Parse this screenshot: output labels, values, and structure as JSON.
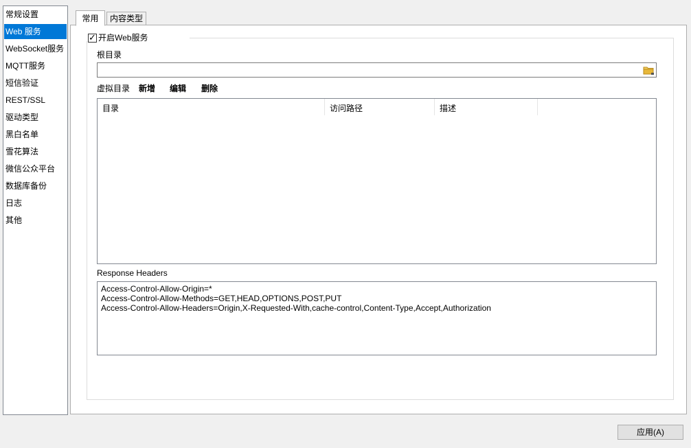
{
  "sidebar": {
    "items": [
      {
        "label": "常规设置"
      },
      {
        "label": "Web 服务"
      },
      {
        "label": "WebSocket服务"
      },
      {
        "label": "MQTT服务"
      },
      {
        "label": "短信验证"
      },
      {
        "label": "REST/SSL"
      },
      {
        "label": "驱动类型"
      },
      {
        "label": "黑白名单"
      },
      {
        "label": "雪花算法"
      },
      {
        "label": "微信公众平台"
      },
      {
        "label": "数据库备份"
      },
      {
        "label": "日志"
      },
      {
        "label": "其他"
      }
    ],
    "selected": "Web 服务"
  },
  "tabs": [
    {
      "label": "常用",
      "active": true
    },
    {
      "label": "内容类型",
      "active": false
    }
  ],
  "web": {
    "enable_label": "开启Web服务",
    "enable_checked": true,
    "root_dir_label": "根目录",
    "root_dir_value": "",
    "virtual_dir_label": "虚拟目录",
    "actions": {
      "add": "新增",
      "edit": "编辑",
      "delete": "删除"
    },
    "columns": [
      {
        "label": "目录"
      },
      {
        "label": "访问路径"
      },
      {
        "label": "描述"
      }
    ],
    "rows": [],
    "response_headers_label": "Response Headers",
    "response_headers": [
      "Access-Control-Allow-Origin=*",
      "Access-Control-Allow-Methods=GET,HEAD,OPTIONS,POST,PUT",
      "Access-Control-Allow-Headers=Origin,X-Requested-With,cache-control,Content-Type,Accept,Authorization"
    ]
  },
  "footer": {
    "apply_label": "应用(A)"
  },
  "icons": {
    "folder": "folder-open-icon",
    "check": "checkmark-icon"
  },
  "colors": {
    "selection": "#0078d7",
    "folder": "#e8b83a"
  }
}
